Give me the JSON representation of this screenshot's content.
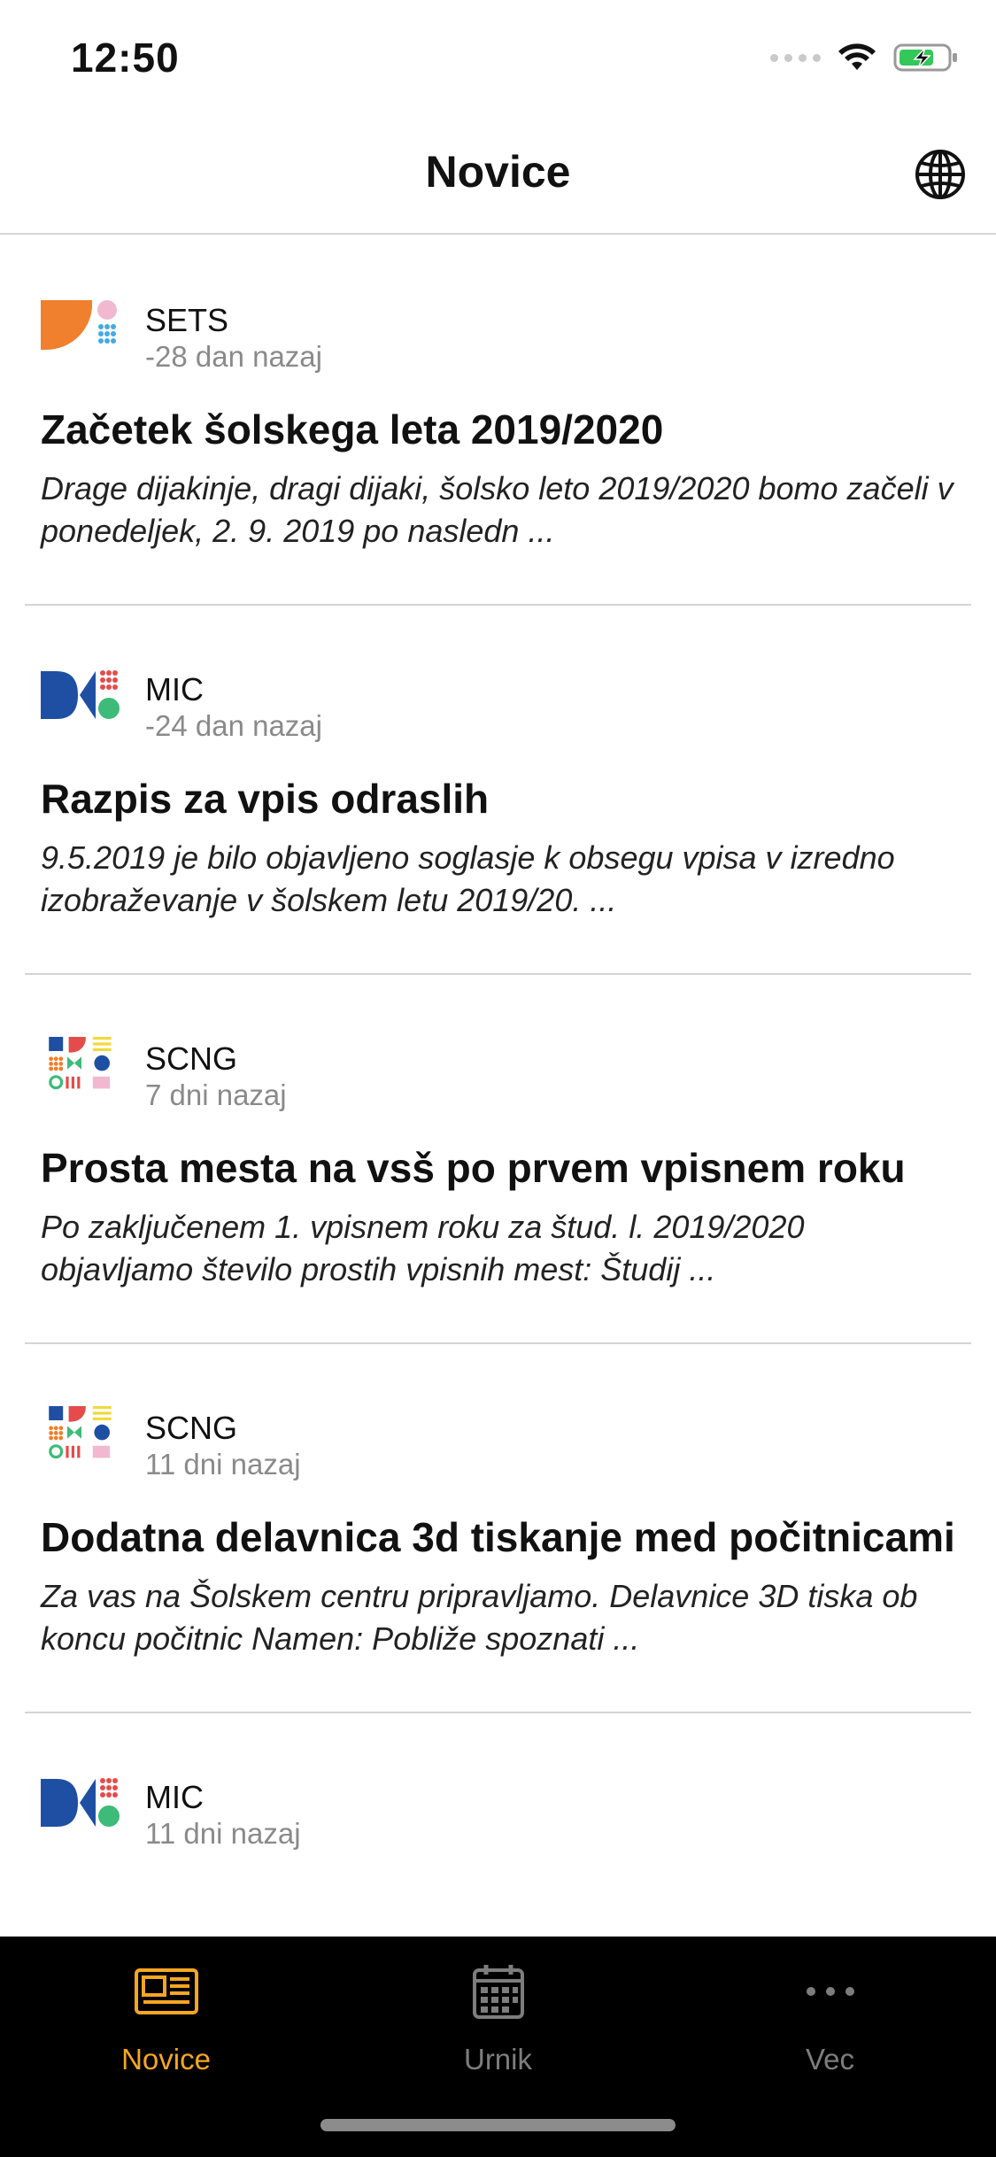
{
  "status_bar": {
    "time": "12:50"
  },
  "nav": {
    "title": "Novice",
    "language_icon": "globe-icon"
  },
  "news": [
    {
      "source": "SETS",
      "logo": "sets-logo",
      "time": "-28 dan nazaj",
      "title": "Začetek šolskega leta 2019/2020",
      "excerpt": "Drage dijakinje, dragi dijaki, šolsko leto 2019/2020 bomo začeli v ponedeljek, 2. 9. 2019 po nasledn ..."
    },
    {
      "source": "MIC",
      "logo": "mic-logo",
      "time": "-24 dan nazaj",
      "title": "Razpis za vpis odraslih",
      "excerpt": "9.5.2019 je bilo objavljeno soglasje k obsegu vpisa v izredno izobraževanje v šolskem letu 2019/20.  ..."
    },
    {
      "source": "SCNG",
      "logo": "scng-logo",
      "time": "7 dni nazaj",
      "title": "Prosta mesta na vsš po prvem vpisnem roku",
      "excerpt": "Po zaključenem 1. vpisnem roku za štud. l. 2019/2020 objavljamo število prostih vpisnih mest: Študij ..."
    },
    {
      "source": "SCNG",
      "logo": "scng-logo",
      "time": "11 dni nazaj",
      "title": "Dodatna delavnica 3d tiskanje med počitnicami",
      "excerpt": "Za vas na Šolskem centru pripravljamo. Delavnice 3D tiska ob koncu počitnic Namen: Pobliže spoznati  ..."
    },
    {
      "source": "MIC",
      "logo": "mic-logo",
      "time": "11 dni nazaj"
    }
  ],
  "tabs": [
    {
      "label": "Novice",
      "icon": "newspaper-icon",
      "active": true
    },
    {
      "label": "Urnik",
      "icon": "calendar-icon",
      "active": false
    },
    {
      "label": "Vec",
      "icon": "more-icon",
      "active": false
    }
  ],
  "colors": {
    "accent": "#f5a623",
    "tab_inactive": "#7d7d7d",
    "tab_bar": "#000000"
  }
}
